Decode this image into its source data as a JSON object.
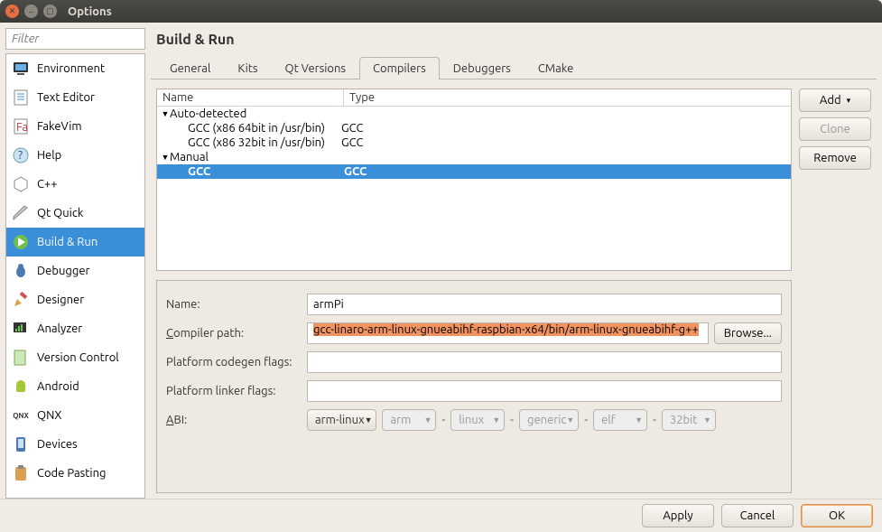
{
  "window": {
    "title": "Options"
  },
  "sidebar": {
    "filter_placeholder": "Filter",
    "items": [
      {
        "label": "Environment"
      },
      {
        "label": "Text Editor"
      },
      {
        "label": "FakeVim"
      },
      {
        "label": "Help"
      },
      {
        "label": "C++"
      },
      {
        "label": "Qt Quick"
      },
      {
        "label": "Build & Run"
      },
      {
        "label": "Debugger"
      },
      {
        "label": "Designer"
      },
      {
        "label": "Analyzer"
      },
      {
        "label": "Version Control"
      },
      {
        "label": "Android"
      },
      {
        "label": "QNX"
      },
      {
        "label": "Devices"
      },
      {
        "label": "Code Pasting"
      }
    ]
  },
  "page": {
    "title": "Build & Run"
  },
  "tabs": [
    {
      "label": "General"
    },
    {
      "label": "Kits"
    },
    {
      "label": "Qt Versions"
    },
    {
      "label": "Compilers"
    },
    {
      "label": "Debuggers"
    },
    {
      "label": "CMake"
    }
  ],
  "tree": {
    "headers": {
      "name": "Name",
      "type": "Type"
    },
    "groups": [
      {
        "label": "Auto-detected",
        "items": [
          {
            "name": "GCC (x86 64bit in /usr/bin)",
            "type": "GCC"
          },
          {
            "name": "GCC (x86 32bit in /usr/bin)",
            "type": "GCC"
          }
        ]
      },
      {
        "label": "Manual",
        "items": [
          {
            "name": "GCC",
            "type": "GCC"
          }
        ]
      }
    ]
  },
  "form": {
    "name_label": "Name:",
    "name_value": "armPi",
    "path_label": "Compiler path:",
    "path_value": "gcc-linaro-arm-linux-gnueabihf-raspbian-x64/bin/arm-linux-gnueabihf-g++",
    "browse": "Browse...",
    "codegen_label": "Platform codegen flags:",
    "codegen_value": "",
    "linker_label": "Platform linker flags:",
    "linker_value": "",
    "abi_label_prefix": "A",
    "abi_label_rest": "BI:",
    "abi": {
      "sel": "arm-linux",
      "a": "arm",
      "b": "linux",
      "c": "generic",
      "d": "elf",
      "e": "32bit"
    }
  },
  "buttons": {
    "add": "Add",
    "clone": "Clone",
    "remove": "Remove",
    "apply": "Apply",
    "cancel": "Cancel",
    "ok": "OK"
  }
}
